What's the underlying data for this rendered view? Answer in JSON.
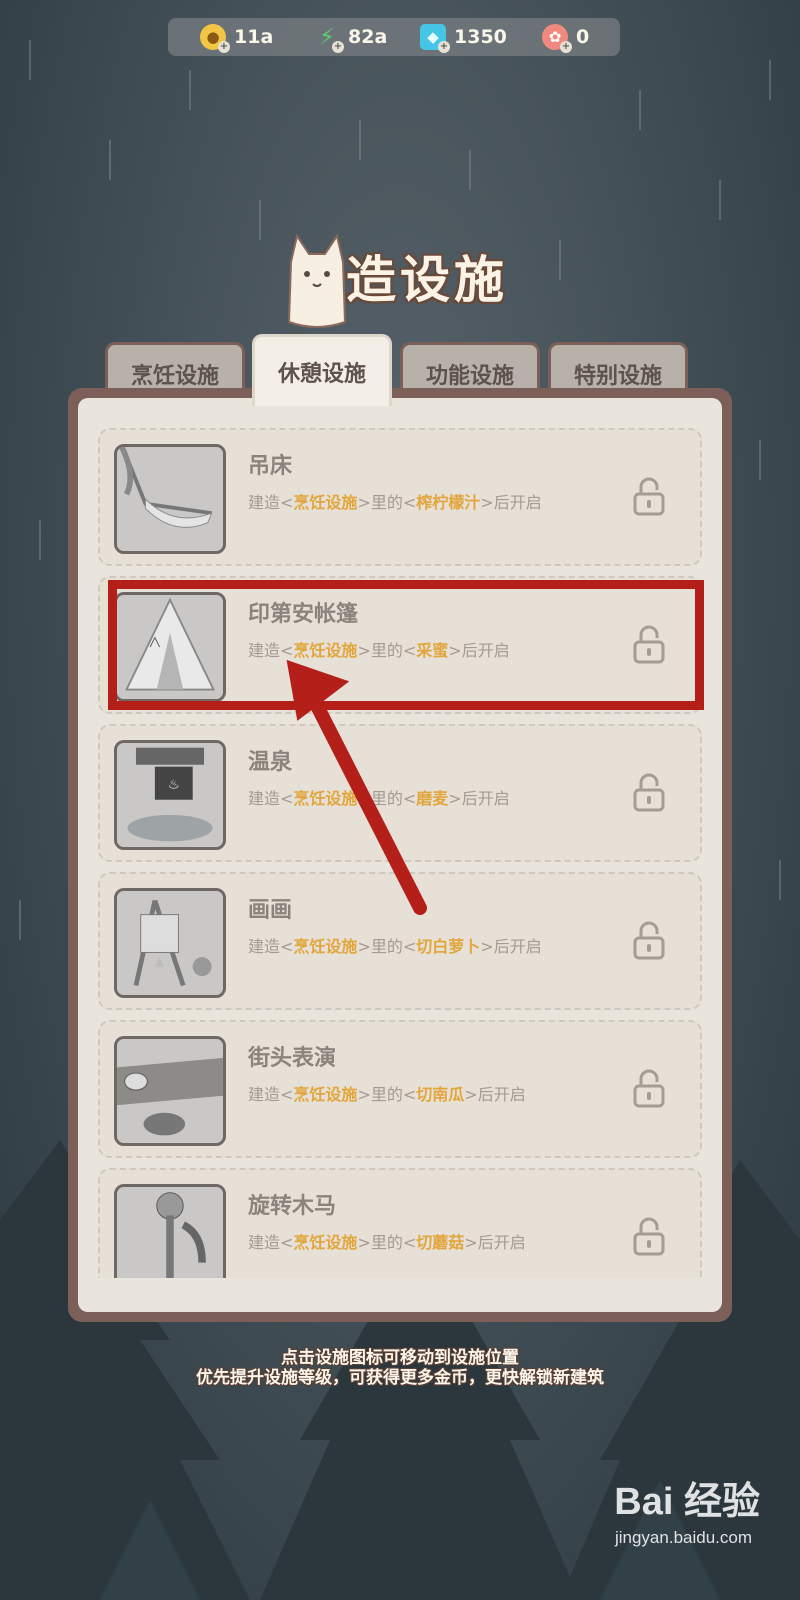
{
  "resources": [
    {
      "icon": "coin-icon",
      "value": "11a",
      "color": "#f2c545"
    },
    {
      "icon": "energy-icon",
      "value": "82a",
      "color": "#5bd06a"
    },
    {
      "icon": "gem-icon",
      "value": "1350",
      "color": "#46c6e6"
    },
    {
      "icon": "ticket-icon",
      "value": "0",
      "color": "#f08a80"
    }
  ],
  "title": "建造设施",
  "tabs": [
    "烹饪设施",
    "休憩设施",
    "功能设施",
    "特别设施"
  ],
  "active_tab": "休憩设施",
  "facilities": [
    {
      "name": "吊床",
      "pre": "建造<",
      "cat": "烹饪设施",
      "mid": ">里的<",
      "item": "榨柠檬汁",
      "post": ">后开启",
      "locked": true
    },
    {
      "name": "印第安帐篷",
      "pre": "建造<",
      "cat": "烹饪设施",
      "mid": ">里的<",
      "item": "采蜜",
      "post": ">后开启",
      "locked": true
    },
    {
      "name": "温泉",
      "pre": "建造<",
      "cat": "烹饪设施",
      "mid": ">里的<",
      "item": "磨麦",
      "post": ">后开启",
      "locked": true
    },
    {
      "name": "画画",
      "pre": "建造<",
      "cat": "烹饪设施",
      "mid": ">里的<",
      "item": "切白萝卜",
      "post": ">后开启",
      "locked": true
    },
    {
      "name": "街头表演",
      "pre": "建造<",
      "cat": "烹饪设施",
      "mid": ">里的<",
      "item": "切南瓜",
      "post": ">后开启",
      "locked": true
    },
    {
      "name": "旋转木马",
      "pre": "建造<",
      "cat": "烹饪设施",
      "mid": ">里的<",
      "item": "切蘑菇",
      "post": ">后开启",
      "locked": true
    }
  ],
  "hints": [
    "点击设施图标可移动到设施位置",
    "优先提升设施等级，可获得更多金币，更快解锁新建筑"
  ],
  "watermark": {
    "main": "Bai 经验",
    "sub": "jingyan.baidu.com"
  },
  "annotation_color": "#b41f1a"
}
